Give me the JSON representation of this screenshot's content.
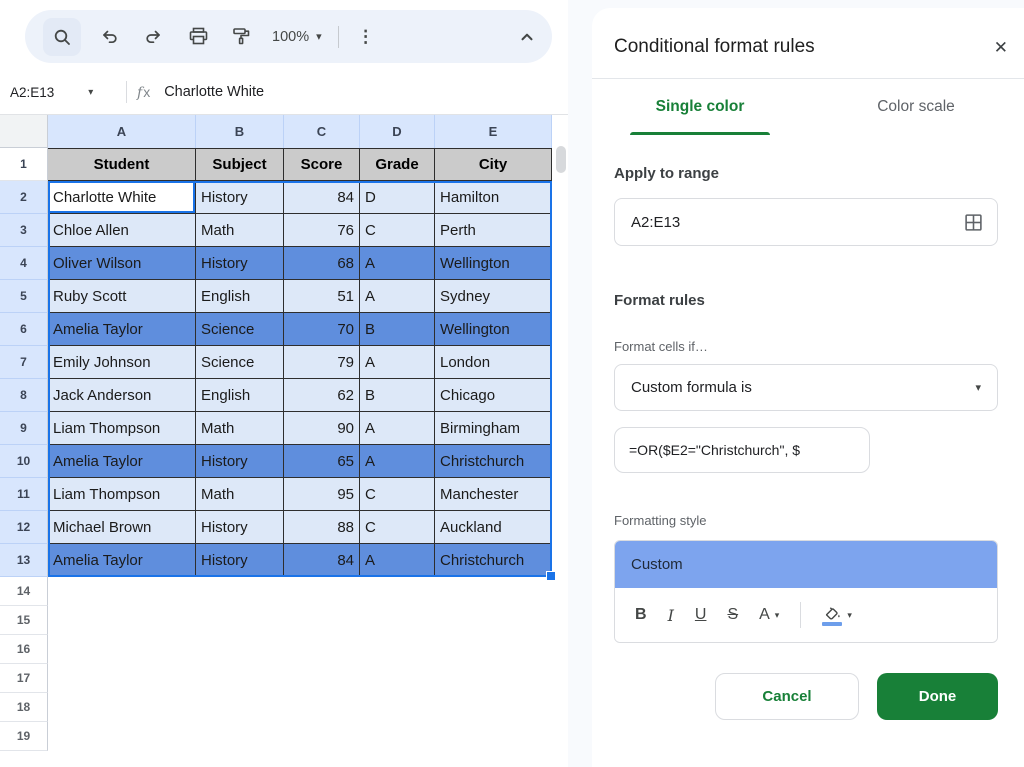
{
  "toolbar": {
    "zoom_label": "100%",
    "kebab_icon": "⋮",
    "caret_down": "▾"
  },
  "formula_bar": {
    "name_box_value": "A2:E13",
    "fx_label": "fx",
    "content": "Charlotte White",
    "caret_down": "▾"
  },
  "grid": {
    "columns": [
      "A",
      "B",
      "C",
      "D",
      "E"
    ],
    "header_row_number": "1",
    "header_row": [
      "Student",
      "Subject",
      "Score",
      "Grade",
      "City"
    ],
    "rows": [
      {
        "n": "2",
        "cells": [
          "Charlotte White",
          "History",
          "84",
          "D",
          "Hamilton"
        ],
        "highlight": false,
        "active": true
      },
      {
        "n": "3",
        "cells": [
          "Chloe Allen",
          "Math",
          "76",
          "C",
          "Perth"
        ],
        "highlight": false
      },
      {
        "n": "4",
        "cells": [
          "Oliver Wilson",
          "History",
          "68",
          "A",
          "Wellington"
        ],
        "highlight": true
      },
      {
        "n": "5",
        "cells": [
          "Ruby Scott",
          "English",
          "51",
          "A",
          "Sydney"
        ],
        "highlight": false
      },
      {
        "n": "6",
        "cells": [
          "Amelia Taylor",
          "Science",
          "70",
          "B",
          "Wellington"
        ],
        "highlight": true
      },
      {
        "n": "7",
        "cells": [
          "Emily Johnson",
          "Science",
          "79",
          "A",
          "London"
        ],
        "highlight": false
      },
      {
        "n": "8",
        "cells": [
          "Jack Anderson",
          "English",
          "62",
          "B",
          "Chicago"
        ],
        "highlight": false
      },
      {
        "n": "9",
        "cells": [
          "Liam Thompson",
          "Math",
          "90",
          "A",
          "Birmingham"
        ],
        "highlight": false
      },
      {
        "n": "10",
        "cells": [
          "Amelia Taylor",
          "History",
          "65",
          "A",
          "Christchurch"
        ],
        "highlight": true
      },
      {
        "n": "11",
        "cells": [
          "Liam Thompson",
          "Math",
          "95",
          "C",
          "Manchester"
        ],
        "highlight": false
      },
      {
        "n": "12",
        "cells": [
          "Michael Brown",
          "History",
          "88",
          "C",
          "Auckland"
        ],
        "highlight": false
      },
      {
        "n": "13",
        "cells": [
          "Amelia Taylor",
          "History",
          "84",
          "A",
          "Christchurch"
        ],
        "highlight": true
      }
    ],
    "empty_row_numbers": [
      "14",
      "15",
      "16",
      "17",
      "18",
      "19"
    ]
  },
  "panel": {
    "title": "Conditional format rules",
    "close_icon": "✕",
    "tabs": [
      {
        "label": "Single color",
        "active": true
      },
      {
        "label": "Color scale",
        "active": false
      }
    ],
    "apply_to_range": {
      "heading": "Apply to range",
      "value": "A2:E13"
    },
    "format_rules": {
      "heading": "Format rules",
      "condition_label": "Format cells if…",
      "condition_value": "Custom formula is",
      "caret_down": "▾",
      "formula_value": "=OR($E2=\"Christchurch\", $"
    },
    "formatting_style": {
      "label": "Formatting style",
      "preview_text": "Custom",
      "bold_label": "B",
      "italic_label": "I",
      "underline_label": "U",
      "strikethrough_label": "S",
      "text_color_label": "A",
      "caret_down": "▾"
    },
    "buttons": {
      "cancel": "Cancel",
      "done": "Done"
    }
  },
  "colors": {
    "selection_accent": "#1a73e8",
    "conditional_highlight": "#5f8edd",
    "selection_tint": "#dde8f8",
    "column_header_selected": "#d8e6fd",
    "table_header_gray": "#cbcbcb",
    "panel_green": "#188038",
    "style_preview_blue": "#7da4ee"
  }
}
